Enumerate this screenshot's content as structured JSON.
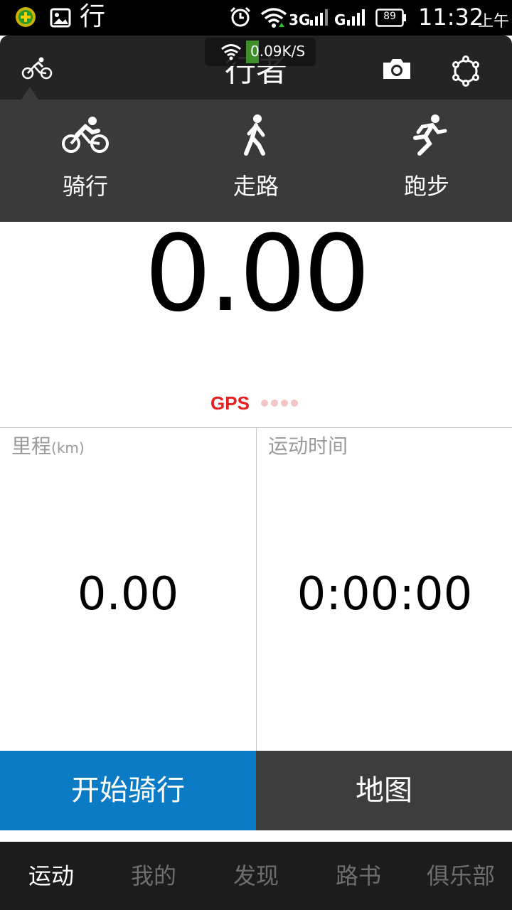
{
  "status_bar": {
    "app_char": "行",
    "battery": "89",
    "time": "11:32",
    "ampm": "上午"
  },
  "speed_toast": {
    "text": "0.09K/S"
  },
  "title_bar": {
    "title": "行者"
  },
  "modes": [
    {
      "label": "骑行",
      "icon": "cycling-icon"
    },
    {
      "label": "走路",
      "icon": "walking-icon"
    },
    {
      "label": "跑步",
      "icon": "running-icon"
    }
  ],
  "speed": {
    "value": "0.00"
  },
  "gps": {
    "label": "GPS",
    "signal_dots": 4
  },
  "stats": {
    "distance": {
      "label": "里程",
      "unit": "(km)",
      "value": "0.00"
    },
    "time": {
      "label": "运动时间",
      "value": "0:00:00"
    }
  },
  "actions": {
    "start": "开始骑行",
    "map": "地图"
  },
  "bottom_nav": [
    {
      "label": "运动",
      "active": true
    },
    {
      "label": "我的",
      "active": false
    },
    {
      "label": "发现",
      "active": false
    },
    {
      "label": "路书",
      "active": false
    },
    {
      "label": "俱乐部",
      "active": false
    }
  ],
  "colors": {
    "accent_blue": "#0a7bc4",
    "gps_red": "#e62020",
    "dark_panel": "#3a3a3a"
  }
}
